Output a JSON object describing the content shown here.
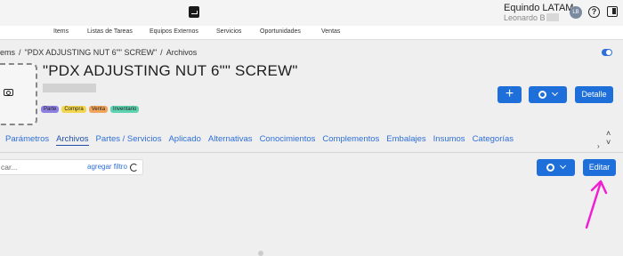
{
  "header": {
    "company": "Equindo LATAM",
    "user_name": "Leonardo B",
    "avatar_initials": "LB",
    "help_glyph": "?"
  },
  "nav": {
    "items": [
      "Items",
      "Listas de Tareas",
      "Equipos Externos",
      "Servicios",
      "Oportunidades",
      "Ventas"
    ]
  },
  "breadcrumb": {
    "items": [
      "Items",
      "/",
      "\"PDX ADJUSTING NUT 6\"\" SCREW\"",
      "/",
      "Archivos"
    ]
  },
  "item": {
    "title": "\"PDX ADJUSTING NUT 6\"\" SCREW\"",
    "tags": [
      {
        "label": "Parte",
        "color": "#8b7fe0"
      },
      {
        "label": "Compra",
        "color": "#f3d64f"
      },
      {
        "label": "Venta",
        "color": "#f2a45a"
      },
      {
        "label": "Inventario",
        "color": "#5fd3b0"
      }
    ]
  },
  "actions": {
    "add_label": "+",
    "detail_label": "Detalle"
  },
  "tabs": [
    "Parámetros",
    "Archivos",
    "Partes / Servicios",
    "Aplicado",
    "Alternativas",
    "Conocimientos",
    "Complementos",
    "Embalajes",
    "Insumos",
    "Categorías"
  ],
  "active_tab": "Archivos",
  "filter": {
    "search_placeholder": "car...",
    "add_filter_label": "agregar filtro"
  },
  "toolbar": {
    "edit_label": "Editar"
  },
  "colors": {
    "primary": "#1e6fd9",
    "link": "#2f6fd8",
    "annotation_arrow": "#f21fd0"
  }
}
